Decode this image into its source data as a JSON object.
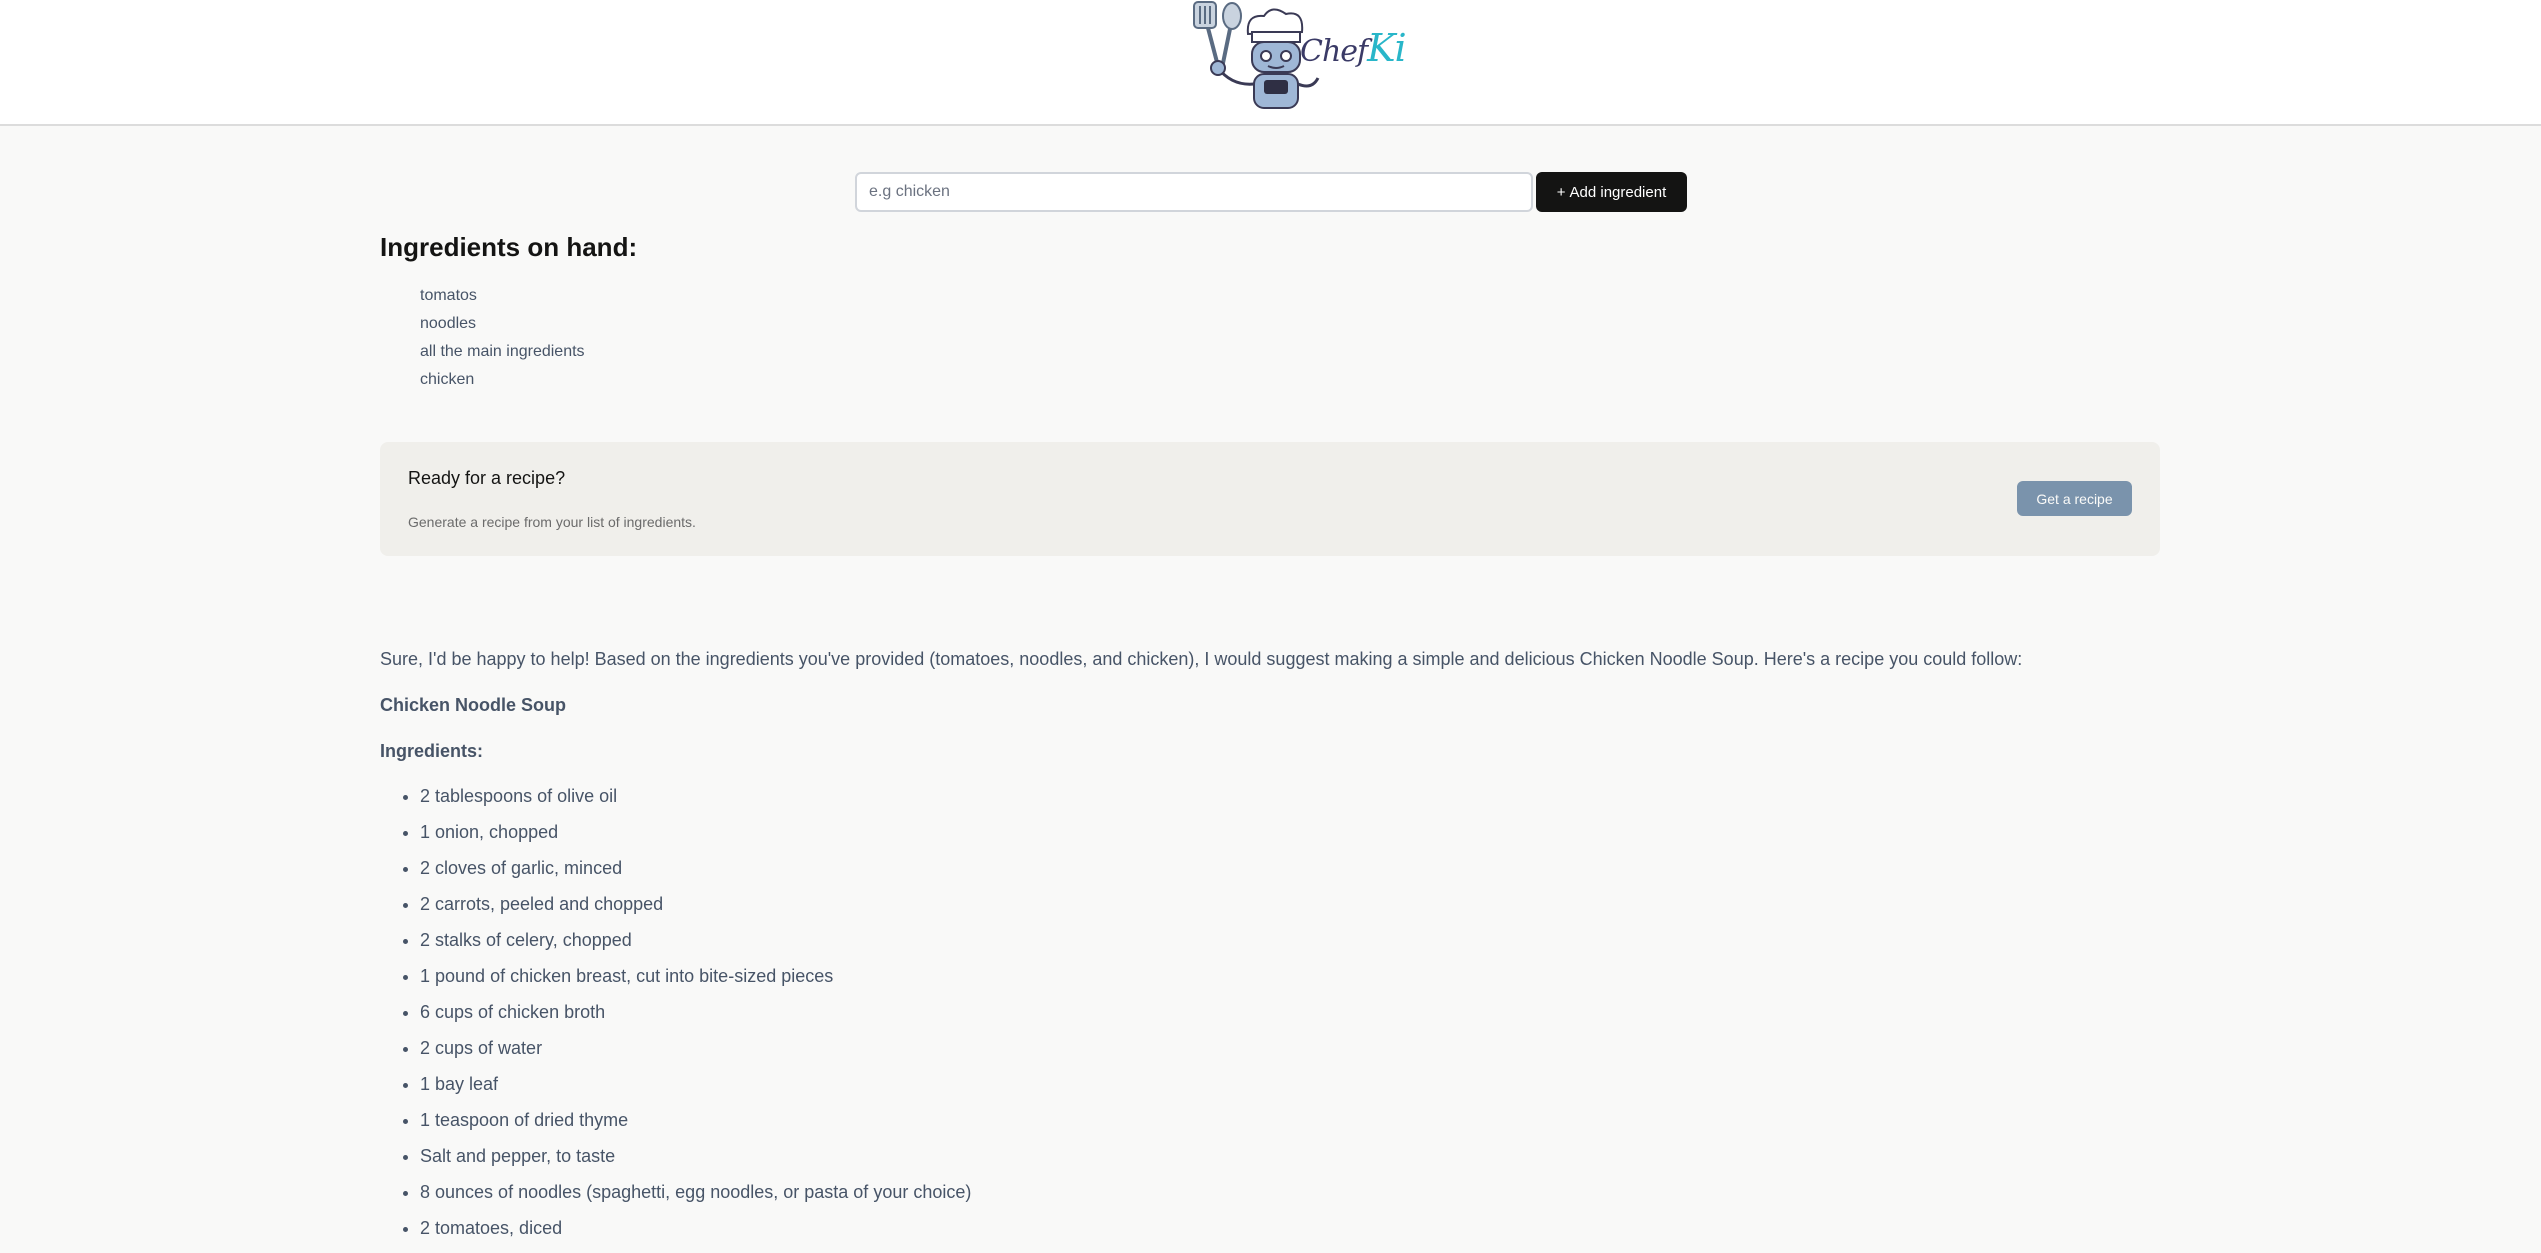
{
  "header": {
    "logo_name": "chef-robot-logo",
    "logo_word_main": "Chef",
    "logo_word_accent": "Ki"
  },
  "add_form": {
    "placeholder": "e.g chicken",
    "value": "",
    "button_label": "Add ingredient",
    "button_icon": "plus-icon"
  },
  "ingredients_section": {
    "title": "Ingredients on hand:",
    "items": [
      "tomatos",
      "noodles",
      "all the main ingredients",
      "chicken"
    ]
  },
  "cta": {
    "title": "Ready for a recipe?",
    "subtitle": "Generate a recipe from your list of ingredients.",
    "button_label": "Get a recipe"
  },
  "recipe": {
    "intro": "Sure, I'd be happy to help! Based on the ingredients you've provided (tomatoes, noodles, and chicken), I would suggest making a simple and delicious Chicken Noodle Soup. Here's a recipe you could follow:",
    "name": "Chicken Noodle Soup",
    "ingredients_heading": "Ingredients:",
    "ingredients": [
      "2 tablespoons of olive oil",
      "1 onion, chopped",
      "2 cloves of garlic, minced",
      "2 carrots, peeled and chopped",
      "2 stalks of celery, chopped",
      "1 pound of chicken breast, cut into bite-sized pieces",
      "6 cups of chicken broth",
      "2 cups of water",
      "1 bay leaf",
      "1 teaspoon of dried thyme",
      "Salt and pepper, to taste",
      "8 ounces of noodles (spaghetti, egg noodles, or pasta of your choice)",
      "2 tomatoes, diced"
    ]
  },
  "colors": {
    "page_bg": "#f9f9f8",
    "primary_button": "#141413",
    "disabled_like_button": "#7a93ac",
    "cta_bg": "#f0efeb",
    "accent": "#29b6c9"
  }
}
